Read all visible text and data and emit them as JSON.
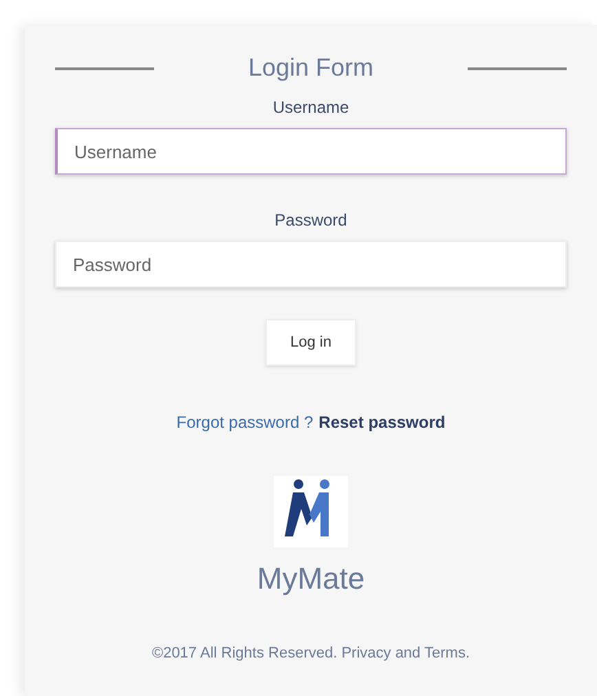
{
  "form": {
    "title": "Login Form"
  },
  "fields": [
    {
      "label": "Username",
      "placeholder": "Username",
      "focused": true
    },
    {
      "label": "Password",
      "placeholder": "Password",
      "focused": false
    }
  ],
  "submit": "Log in",
  "links": [
    {
      "text": "Forgot password ?",
      "kind": "plain"
    },
    {
      "text": "Reset password",
      "kind": "strong"
    }
  ],
  "brand": {
    "name": "MyMate"
  },
  "footer": "©2017 All Rights Reserved. Privacy and Terms."
}
